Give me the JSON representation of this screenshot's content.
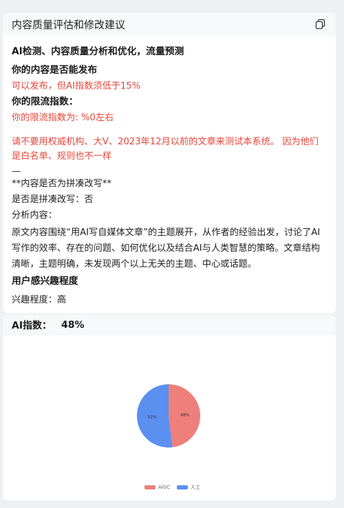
{
  "card": {
    "title": "内容质量评估和修改建议",
    "copy_icon": "copy-icon",
    "lines": {
      "section_title": "AI检测、内容质量分析和优化，流量预测",
      "publish_q": "你的内容是否能发布",
      "publish_a": "可以发布，但AI指数须低于15%",
      "limit_q": "你的限流指数：",
      "limit_a": "你的限流指数为: %0左右",
      "notice": "请不要用权威机构、大V、2023年12月以前的文章来测试本系统。 因为他们是白名单、规则也不一样",
      "dash": "—",
      "patch_title": "**内容是否为拼凑改写**",
      "patch_a": "是否是拼凑改写：否",
      "analysis_label": "分析内容：",
      "analysis_text": "原文内容围绕“用AI写自媒体文章”的主题展开，从作者的经验出发，讨论了AI写作的效率、存在的问题、如何优化以及结合AI与人类智慧的策略。文章结构清晰，主题明确，未发现两个以上无关的主题、中心或话题。",
      "interest_title": "用户感兴趣程度",
      "interest_a": "兴趣程度：高"
    }
  },
  "ai_index": {
    "label": "AI指数：",
    "value": "48%"
  },
  "chart_data": {
    "type": "pie",
    "slices": [
      {
        "name": "AIGC",
        "value": 48,
        "label": "48%",
        "color": "#ee7f7a"
      },
      {
        "name": "人工",
        "value": 52,
        "label": "52%",
        "color": "#5b8ff0"
      }
    ],
    "legend": "bottom"
  }
}
